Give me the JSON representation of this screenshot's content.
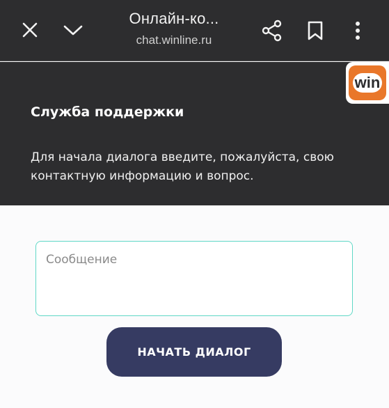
{
  "browser": {
    "title": "Онлайн-ко...",
    "url": "chat.winline.ru",
    "icons": [
      "close-icon",
      "chevron-down-icon",
      "share-icon",
      "bookmark-icon",
      "more-vert-icon"
    ]
  },
  "logo": {
    "text": "win",
    "colors": {
      "ring": "#e9772a",
      "bg": "#ffffff"
    }
  },
  "support": {
    "title": "Служба поддержки",
    "description": "Для начала диалога введите, пожалуйста, свою контактную информацию и вопрос."
  },
  "form": {
    "message_placeholder": "Сообщение",
    "message_value": "",
    "start_button": "НАЧАТЬ ДИАЛОГ"
  },
  "colors": {
    "header_bg": "#2d2d2f",
    "accent_border": "#5fd8c6",
    "button_bg": "#363b62"
  }
}
